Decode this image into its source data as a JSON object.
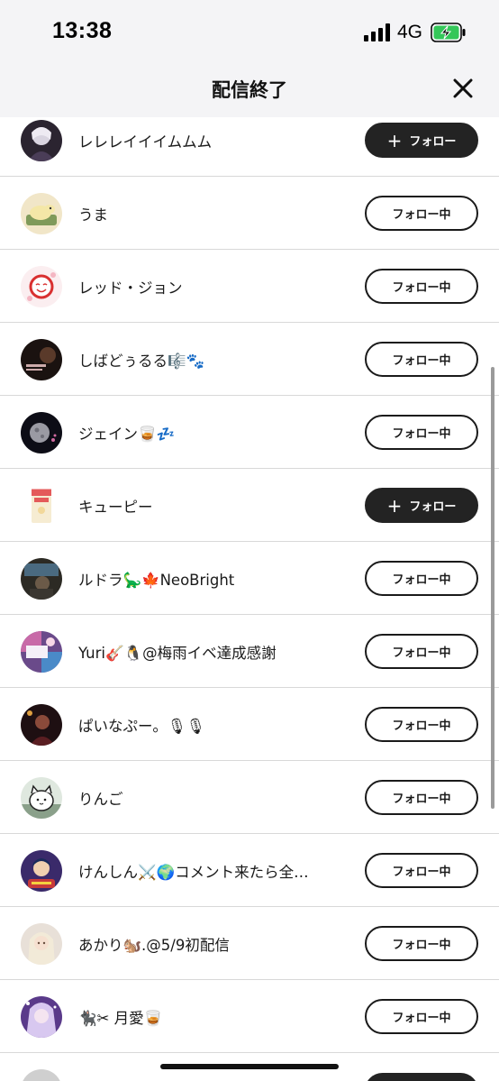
{
  "status_bar": {
    "time": "13:38",
    "network": "4G",
    "signal_icon": "cellular-signal-icon",
    "battery_icon": "battery-charging-icon",
    "battery_color": "#34c759"
  },
  "header": {
    "title": "配信終了",
    "close_icon": "close-icon"
  },
  "buttons": {
    "follow_label": "フォロー",
    "following_label": "フォロー中",
    "plus": "+"
  },
  "users": [
    {
      "name": "レレレイイイムムム",
      "status": "follow"
    },
    {
      "name": "うま",
      "status": "following"
    },
    {
      "name": "レッド・ジョン",
      "status": "following"
    },
    {
      "name": "しばどぅるる🎼🐾",
      "status": "following"
    },
    {
      "name": "ジェイン🥃💤",
      "status": "following"
    },
    {
      "name": "キューピー",
      "status": "follow"
    },
    {
      "name": "ルドラ🦕🍁NeoBright",
      "status": "following"
    },
    {
      "name": " Yuri🎸🐧@梅雨イベ達成感謝",
      "status": "following"
    },
    {
      "name": "ぱいなぷー。🎙🎙",
      "status": "following"
    },
    {
      "name": "りんご",
      "status": "following"
    },
    {
      "name": "けんしん⚔️🌍コメント来たら全…",
      "status": "following"
    },
    {
      "name": "あかり🐿️‪‪.@5/9初配信",
      "status": "following"
    },
    {
      "name": "🐈‍⬛✂︎ 月愛🥃",
      "status": "following"
    }
  ],
  "colors": {
    "follow_bg": "#232323",
    "following_border": "#1a1a1a",
    "header_bg": "#f4f4f6",
    "divider": "#d8d8d8"
  }
}
